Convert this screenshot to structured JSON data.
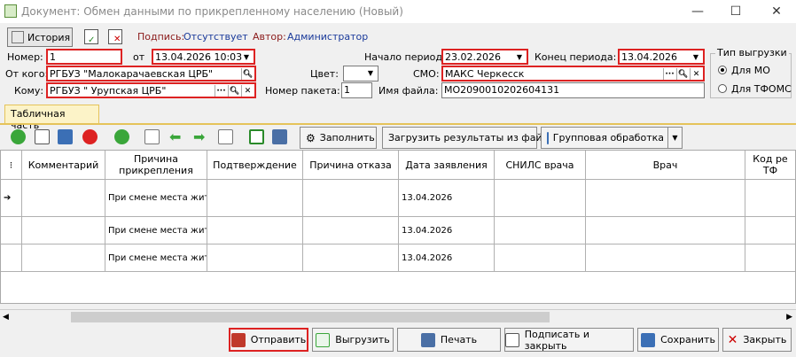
{
  "window": {
    "title": "Документ: Обмен данными по прикрепленному населению (Новый)"
  },
  "toolbar": {
    "history_label": "История",
    "signature_label": "Подпись:",
    "signature_value": "Отсутствует",
    "author_label": "Автор:",
    "author_value": "Администратор"
  },
  "form": {
    "number_label": "Номер:",
    "number_value": "1",
    "from_date_label": "от",
    "from_date_value": "13.04.2026 10:03",
    "period_start_label": "Начало периода:",
    "period_start_value": "23.02.2026",
    "period_end_label": "Конец периода:",
    "period_end_value": "13.04.2026",
    "from_label": "От кого:",
    "from_value": "РГБУЗ \"Малокарачаевская ЦРБ\"",
    "color_label": "Цвет:",
    "color_value": "",
    "smo_label": "СМО:",
    "smo_value": "МАКС Черкесск",
    "to_label": "Кому:",
    "to_value": "РГБУЗ \" Урупская ЦРБ\"",
    "packet_label": "Номер пакета:",
    "packet_value": "1",
    "filename_label": "Имя файла:",
    "filename_value": "MO2090010202604131",
    "export_type_title": "Тип выгрузки",
    "export_opt1": "Для МО",
    "export_opt2": "Для ТФОМС"
  },
  "tab": {
    "label": "Табличная часть"
  },
  "table_toolbar": {
    "fill_label": "Заполнить",
    "load_label": "Загрузить результаты из файла",
    "group_label": "Групповая обработка"
  },
  "table": {
    "headers": [
      "Комментарий",
      "Причина прикрепления",
      "Подтверждение",
      "Причина отказа",
      "Дата заявления",
      "СНИЛС врача",
      "Врач",
      "Код ре ТФ"
    ],
    "rows": [
      {
        "reason": "При смене места жите",
        "date": "13.04.2026"
      },
      {
        "reason": "При смене места жите",
        "date": "13.04.2026"
      },
      {
        "reason": "При смене места жите",
        "date": "13.04.2026"
      }
    ]
  },
  "footer": {
    "send_label": "Отправить",
    "export_label": "Выгрузить",
    "print_label": "Печать",
    "sign_close_label": "Подписать и закрыть",
    "save_label": "Сохранить",
    "close_label": "Закрыть"
  },
  "colors": {
    "accent_red": "#d22222",
    "tab_yellow": "#fcf3c8",
    "link_blue": "#1a3a9a"
  }
}
